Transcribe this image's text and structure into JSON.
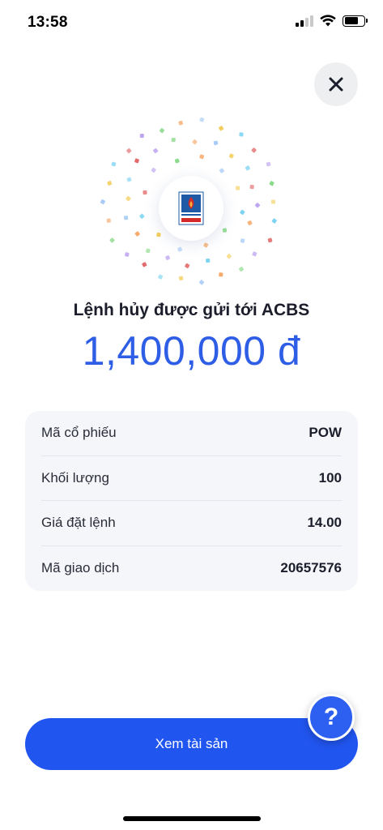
{
  "status_bar": {
    "time": "13:58"
  },
  "header": {
    "close_icon": "close-icon"
  },
  "logo": {
    "brand_lines": [
      "PETROVIETNAM",
      "POWER"
    ],
    "colors": {
      "blue": "#1f5aa6",
      "red": "#d42a2a"
    }
  },
  "result": {
    "title": "Lệnh hủy được gửi tới ACBS",
    "amount": "1,400,000 đ"
  },
  "details": [
    {
      "label": "Mã cổ phiếu",
      "value": "POW"
    },
    {
      "label": "Khối lượng",
      "value": "100"
    },
    {
      "label": "Giá đặt lệnh",
      "value": "14.00"
    },
    {
      "label": "Mã giao dịch",
      "value": "20657576"
    }
  ],
  "footer": {
    "button_label": "Xem tài sản",
    "help_label": "?"
  },
  "colors": {
    "accent": "#2155f0",
    "amount": "#2f5ee6",
    "card_bg": "#f5f6fa"
  }
}
